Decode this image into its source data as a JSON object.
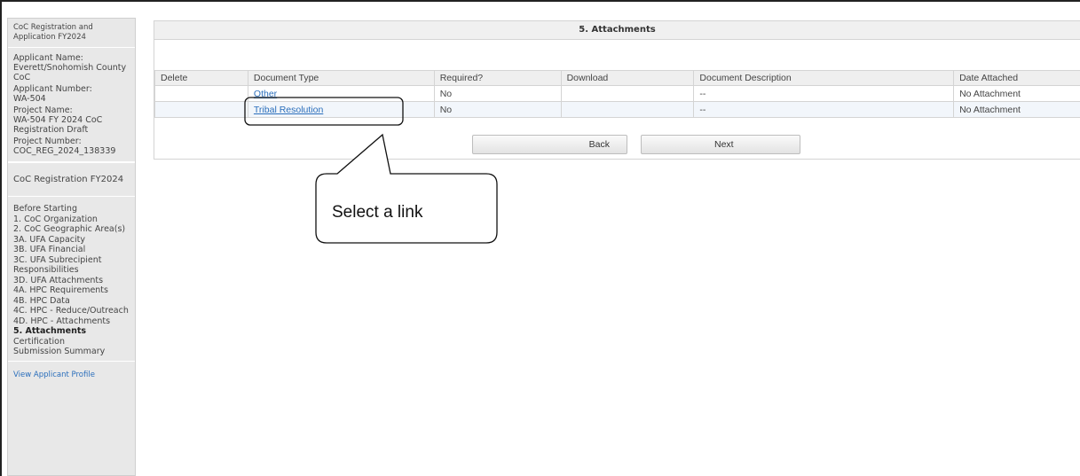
{
  "sidebar": {
    "app_title": "CoC Registration and Application FY2024",
    "info": [
      {
        "label": "Applicant Name:",
        "value": "Everett/Snohomish County CoC"
      },
      {
        "label": "Applicant Number:",
        "value": "WA-504"
      },
      {
        "label": "Project Name:",
        "value": "WA-504 FY 2024 CoC Registration Draft"
      },
      {
        "label": "Project Number:",
        "value": "COC_REG_2024_138339"
      }
    ],
    "section_title": "CoC Registration FY2024",
    "nav": [
      "Before Starting",
      "1. CoC Organization",
      "2. CoC Geographic Area(s)",
      "3A. UFA Capacity",
      "3B. UFA Financial",
      "3C. UFA Subrecipient Responsibilities",
      "3D. UFA Attachments",
      "4A. HPC Requirements",
      "4B. HPC Data",
      "4C. HPC - Reduce/Outreach",
      "4D. HPC - Attachments",
      "5. Attachments",
      "Certification",
      "Submission Summary"
    ],
    "active_nav": "5. Attachments",
    "footer_link": "View Applicant Profile"
  },
  "main": {
    "title": "5. Attachments",
    "columns": [
      "Delete",
      "Document Type",
      "Required?",
      "Download",
      "Document Description",
      "Date Attached"
    ],
    "rows": [
      {
        "delete": "",
        "document_type": "Other",
        "required": "No",
        "download": "",
        "description": "--",
        "date_attached": "No Attachment"
      },
      {
        "delete": "",
        "document_type": "Tribal Resolution",
        "required": "No",
        "download": "",
        "description": "--",
        "date_attached": "No Attachment"
      }
    ],
    "back_label": "Back",
    "next_label": "Next"
  },
  "callout": {
    "text": "Select a link"
  }
}
